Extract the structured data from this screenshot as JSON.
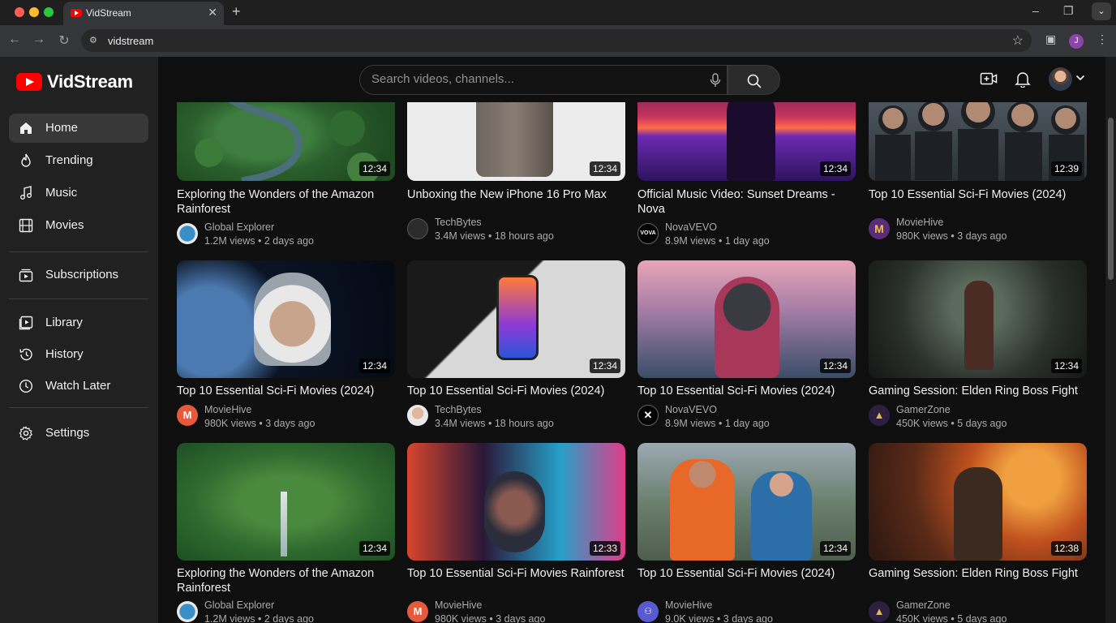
{
  "browser": {
    "tab_title": "VidStream",
    "url": "vidstream"
  },
  "app": {
    "name": "VidStream",
    "search_placeholder": "Search videos, channels..."
  },
  "sidebar": {
    "items": [
      {
        "label": "Home",
        "icon": "home-icon"
      },
      {
        "label": "Trending",
        "icon": "flame-icon"
      },
      {
        "label": "Music",
        "icon": "music-note-icon"
      },
      {
        "label": "Movies",
        "icon": "film-icon"
      },
      {
        "label": "Subscriptions",
        "icon": "subscriptions-icon"
      },
      {
        "label": "Library",
        "icon": "library-icon"
      },
      {
        "label": "History",
        "icon": "history-icon"
      },
      {
        "label": "Watch Later",
        "icon": "clock-icon"
      },
      {
        "label": "Settings",
        "icon": "gear-icon"
      }
    ]
  },
  "videos": [
    {
      "title": "Exploring the Wonders of the Amazon Rainforest",
      "channel": "Global Explorer",
      "meta": "1.2M views • 2 days ago",
      "duration": "12:34"
    },
    {
      "title": "Unboxing the New iPhone 16 Pro Max",
      "channel": "TechBytes",
      "meta": "3.4M views • 18 hours ago",
      "duration": "12:34"
    },
    {
      "title": "Official Music Video: Sunset Dreams - Nova",
      "channel": "NovaVEVO",
      "meta": "8.9M views • 1 day ago",
      "duration": "12:34"
    },
    {
      "title": "Top 10 Essential Sci-Fi Movies (2024)",
      "channel": "MovieHive",
      "meta": "980K views • 3 days ago",
      "duration": "12:39"
    },
    {
      "title": "Top 10 Essential Sci-Fi Movies (2024)",
      "channel": "MovieHive",
      "meta": "980K views • 3 days ago",
      "duration": "12:34"
    },
    {
      "title": "Top 10 Essential Sci-Fi Movies (2024)",
      "channel": "TechBytes",
      "meta": "3.4M views • 18 hours ago",
      "duration": "12:34"
    },
    {
      "title": "Top 10 Essential Sci-Fi Movies (2024)",
      "channel": "NovaVEVO",
      "meta": "8.9M views • 1 day ago",
      "duration": "12:34"
    },
    {
      "title": "Gaming Session: Elden Ring Boss Fight",
      "channel": "GamerZone",
      "meta": "450K views • 5 days ago",
      "duration": "12:34"
    },
    {
      "title": "Exploring the Wonders of the Amazon Rainforest",
      "channel": "Global Explorer",
      "meta": "1.2M views • 2 days ago",
      "duration": "12:34"
    },
    {
      "title": "Top 10 Essential Sci-Fi Movies Rainforest",
      "channel": "MovieHive",
      "meta": "980K views • 3 days ago",
      "duration": "12:33"
    },
    {
      "title": "Top 10 Essential Sci-Fi Movies (2024)",
      "channel": "MovieHive",
      "meta": "9.0K views • 3 days ago",
      "duration": "12:34"
    },
    {
      "title": "Gaming Session: Elden Ring Boss Fight",
      "channel": "GamerZone",
      "meta": "450K views • 5 days ago",
      "duration": "12:38"
    }
  ],
  "colors": {
    "accent": "#ff0000",
    "background": "#0f0f0f",
    "sidebar": "#212121"
  }
}
